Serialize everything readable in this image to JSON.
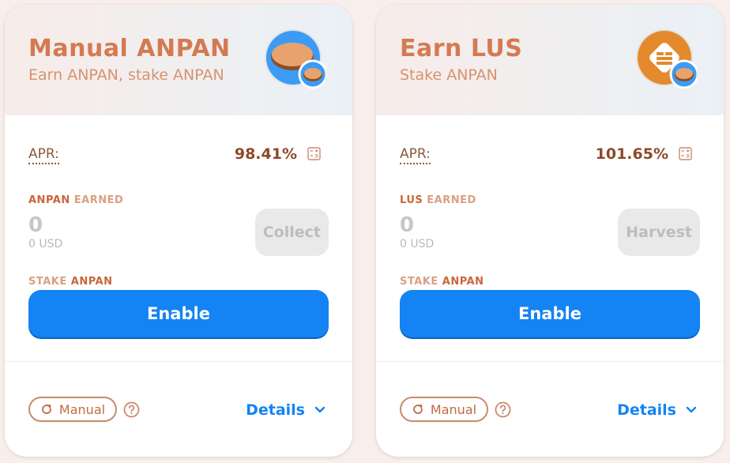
{
  "pools": [
    {
      "title": "Manual ANPAN",
      "subtitle": "Earn ANPAN, stake ANPAN",
      "token_icon": "anpan-coin-icon",
      "apr_label": "APR:",
      "apr_value": "98.41%",
      "earned_token": "ANPAN",
      "earned_word": "EARNED",
      "earned_amount": "0",
      "earned_usd": "0 USD",
      "action_label": "Collect",
      "stake_word": "STAKE",
      "stake_token": "ANPAN",
      "enable_label": "Enable",
      "mode_label": "Manual",
      "details_label": "Details"
    },
    {
      "title": "Earn LUS",
      "subtitle": "Stake ANPAN",
      "token_icon": "lus-token-icon",
      "apr_label": "APR:",
      "apr_value": "101.65%",
      "earned_token": "LUS",
      "earned_word": "EARNED",
      "earned_amount": "0",
      "earned_usd": "0 USD",
      "action_label": "Harvest",
      "stake_word": "STAKE",
      "stake_token": "ANPAN",
      "enable_label": "Enable",
      "mode_label": "Manual",
      "details_label": "Details"
    }
  ],
  "colors": {
    "accent_orange": "#d47a52",
    "primary_blue": "#1483f4",
    "disabled_gray": "#e9e9e9",
    "page_bg": "#f8eeeb"
  }
}
